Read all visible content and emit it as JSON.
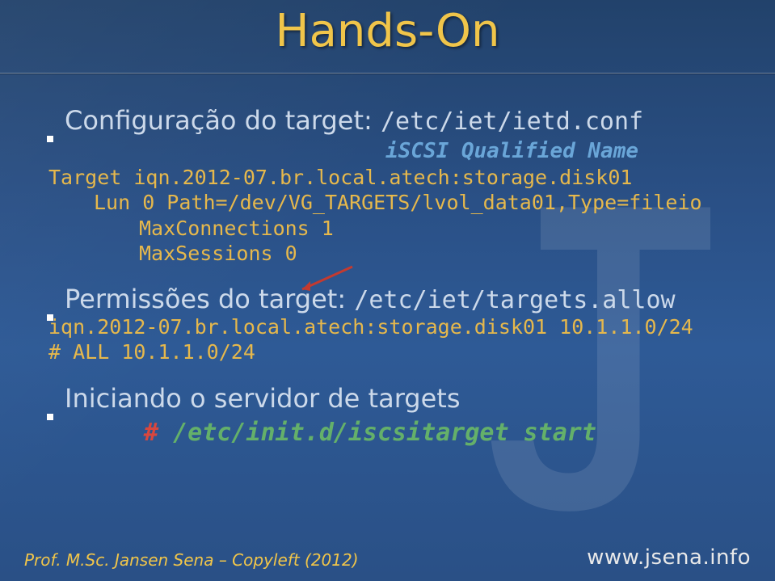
{
  "title": "Hands-On",
  "annotation": "iSCSI Qualified Name",
  "bullets": [
    {
      "text": "Configuração do target: ",
      "mono": "/etc/iet/ietd.conf"
    },
    {
      "text": "Permissões do target: ",
      "mono": "/etc/iet/targets.allow"
    },
    {
      "text": "Iniciando o servidor de targets"
    }
  ],
  "code1": {
    "l1a": "Target ",
    "l1b": "iqn.2012-07.br.local.atech:storage.disk01",
    "l2": "Lun 0 Path=/dev/VG_TARGETS/lvol_data01,Type=fileio",
    "l3": "MaxConnections 1",
    "l4": "MaxSessions 0"
  },
  "code2": {
    "l1": "iqn.2012-07.br.local.atech:storage.disk01 10.1.1.0/24",
    "l2": "# ALL 10.1.1.0/24"
  },
  "command": {
    "prompt": "# ",
    "text": "/etc/init.d/iscsitarget start"
  },
  "footer": {
    "left": "Prof. M.Sc. Jansen Sena – Copyleft (2012)",
    "right": "www.jsena.info"
  }
}
